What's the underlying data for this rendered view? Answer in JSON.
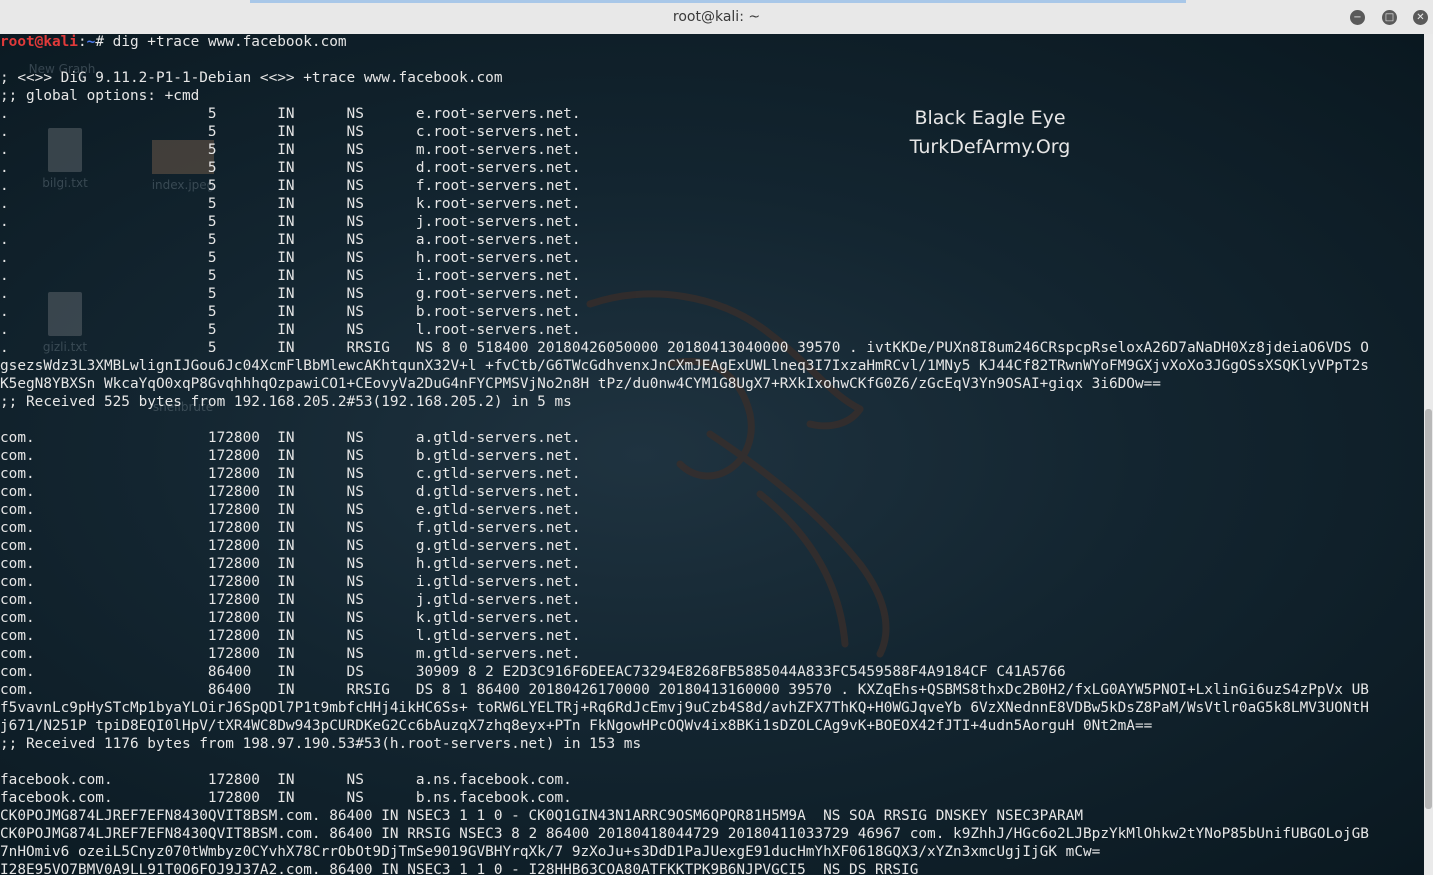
{
  "window": {
    "title": "root@kali: ~",
    "buttons": {
      "minimize": "−",
      "maximize": "□",
      "close": "✕"
    }
  },
  "desktop": {
    "icons": [
      {
        "label": "New Graph",
        "kind": "doc"
      },
      {
        "label": "bilgi.txt",
        "kind": "doc"
      },
      {
        "label": "index.jpeg",
        "kind": "image"
      },
      {
        "label": "gizli.txt",
        "kind": "doc"
      },
      {
        "label": "shellbrute",
        "kind": "folder"
      }
    ]
  },
  "watermark": {
    "line1": "Black Eagle Eye",
    "line2": "TurkDefArmy.Org"
  },
  "prompt": {
    "user": "root@kali",
    "sep": ":",
    "path": "~",
    "symbol": "# ",
    "command": "dig +trace www.facebook.com"
  },
  "lines": [
    "",
    "; <<>> DiG 9.11.2-P1-1-Debian <<>> +trace www.facebook.com",
    ";; global options: +cmd",
    ".                       5       IN      NS      e.root-servers.net.",
    ".                       5       IN      NS      c.root-servers.net.",
    ".                       5       IN      NS      m.root-servers.net.",
    ".                       5       IN      NS      d.root-servers.net.",
    ".                       5       IN      NS      f.root-servers.net.",
    ".                       5       IN      NS      k.root-servers.net.",
    ".                       5       IN      NS      j.root-servers.net.",
    ".                       5       IN      NS      a.root-servers.net.",
    ".                       5       IN      NS      h.root-servers.net.",
    ".                       5       IN      NS      i.root-servers.net.",
    ".                       5       IN      NS      g.root-servers.net.",
    ".                       5       IN      NS      b.root-servers.net.",
    ".                       5       IN      NS      l.root-servers.net.",
    ".                       5       IN      RRSIG   NS 8 0 518400 20180426050000 20180413040000 39570 . ivtKKDe/PUXn8I8um246CRspcpRseloxA26D7aNaDH0Xz8jdeiaO6VDS O",
    "gsezsWdz3L3XMBLwlignIJGou6Jc04XcmFlBbMlewcAKhtqunX32V+l +fvCtb/G6TWcGdhvenxJnCXmJEAgExUWLlneq3I7IxzaHmRCvl/1MNy5 KJ44Cf82TRwnWYoFM9GXjvXoXo3JGgOSsXSQKlyVPpT2s",
    "K5egN8YBXSn WkcaYqO0xqP8GvqhhhqOzpawiCO1+CEovyVa2DuG4nFYCPMSVjNo2n8H tPz/du0nw4CYM1G8UgX7+RXkIxohwCKfG0Z6/zGcEqV3Yn9OSAI+giqx 3i6DOw==",
    ";; Received 525 bytes from 192.168.205.2#53(192.168.205.2) in 5 ms",
    "",
    "com.                    172800  IN      NS      a.gtld-servers.net.",
    "com.                    172800  IN      NS      b.gtld-servers.net.",
    "com.                    172800  IN      NS      c.gtld-servers.net.",
    "com.                    172800  IN      NS      d.gtld-servers.net.",
    "com.                    172800  IN      NS      e.gtld-servers.net.",
    "com.                    172800  IN      NS      f.gtld-servers.net.",
    "com.                    172800  IN      NS      g.gtld-servers.net.",
    "com.                    172800  IN      NS      h.gtld-servers.net.",
    "com.                    172800  IN      NS      i.gtld-servers.net.",
    "com.                    172800  IN      NS      j.gtld-servers.net.",
    "com.                    172800  IN      NS      k.gtld-servers.net.",
    "com.                    172800  IN      NS      l.gtld-servers.net.",
    "com.                    172800  IN      NS      m.gtld-servers.net.",
    "com.                    86400   IN      DS      30909 8 2 E2D3C916F6DEEAC73294E8268FB5885044A833FC5459588F4A9184CF C41A5766",
    "com.                    86400   IN      RRSIG   DS 8 1 86400 20180426170000 20180413160000 39570 . KXZqEhs+QSBMS8thxDc2B0H2/fxLG0AYW5PNOI+LxlinGi6uzS4zPpVx UB",
    "f5vavnLc9pHySTcMp1byaYLOirJ6SpQDl7P1t9mbfcHHj4ikHC6Ss+ toRW6LYELTRj+Rq6RdJcEmvj9uCzb4S8d/avhZFX7ThKQ+H0WGJqveYb 6VzXNednnE8VDBw5kDsZ8PaM/WsVtlr0aG5k8LMV3UONtH",
    "j671/N251P tpiD8EQI0lHpV/tXR4WC8Dw943pCURDKeG2Cc6bAuzqX7zhq8eyx+PTn FkNgowHPcOQWv4ix8BKi1sDZOLCAg9vK+BOEOX42fJTI+4udn5AorguH 0Nt2mA==",
    ";; Received 1176 bytes from 198.97.190.53#53(h.root-servers.net) in 153 ms",
    "",
    "facebook.com.           172800  IN      NS      a.ns.facebook.com.",
    "facebook.com.           172800  IN      NS      b.ns.facebook.com.",
    "CK0POJMG874LJREF7EFN8430QVIT8BSM.com. 86400 IN NSEC3 1 1 0 - CK0Q1GIN43N1ARRC9OSM6QPQR81H5M9A  NS SOA RRSIG DNSKEY NSEC3PARAM",
    "CK0POJMG874LJREF7EFN8430QVIT8BSM.com. 86400 IN RRSIG NSEC3 8 2 86400 20180418044729 20180411033729 46967 com. k9ZhhJ/HGc6o2LJBpzYkMlOhkw2tYNoP85bUnifUBGOLojGB",
    "7nHOmiv6 ozeiL5Cnyz070tWmbyz0CYvhX78CrrObOt9DjTmSe9019GVBHYrqXk/7 9zXoJu+s3DdD1PaJUexgE91ducHmYhXF0618GQX3/xYZn3xmcUgjIjGK mCw=",
    "I28E95VO7BMV0A9LL91T0O6FOJ9J37A2.com. 86400 IN NSEC3 1 1 0 - I28HHB63COA80ATFKKTPK9B6NJPVGCI5  NS DS RRSIG"
  ]
}
